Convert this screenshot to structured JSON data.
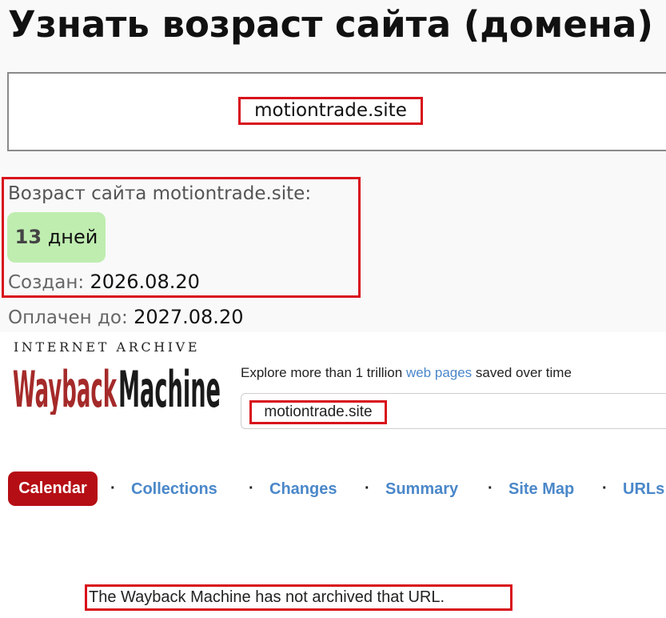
{
  "checker": {
    "title": "Узнать возраст сайта (домена)",
    "domain_input_value": "motiontrade.site",
    "age_label": "Возраст сайта motiontrade.site:",
    "age_number": "13",
    "age_unit": "дней",
    "created_label": "Создан:",
    "created_value": "2026.08.20",
    "paid_label": "Оплачен до:",
    "paid_value": "2027.08.20"
  },
  "wayback": {
    "archive_text": "INTERNET ARCHIVE",
    "logo_text": "WaybackMachine",
    "explore_prefix": "Explore more than 1 trillion",
    "explore_link": "web pages",
    "explore_suffix": "saved over time",
    "search_value": "motiontrade.site",
    "nav": {
      "calendar": "Calendar",
      "collections": "Collections",
      "changes": "Changes",
      "summary": "Summary",
      "sitemap": "Site Map",
      "urls": "URLs"
    },
    "message": "The Wayback Machine has not archived that URL."
  },
  "colors": {
    "highlight_red": "#d8111b",
    "badge_green": "#bfedb0",
    "wayback_red": "#b50e14",
    "link_blue": "#4a87c9"
  }
}
